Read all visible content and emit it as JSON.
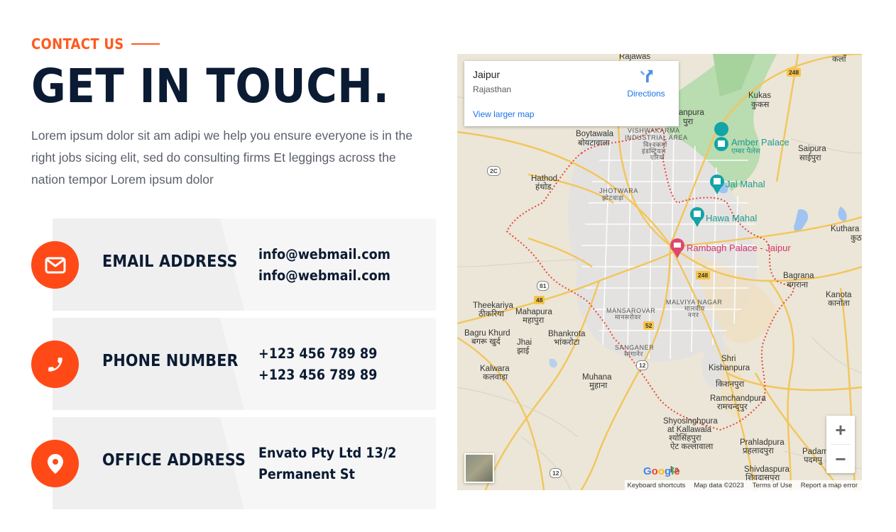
{
  "section": {
    "eyebrow": "CONTACT US",
    "title": "GET IN TOUCH.",
    "intro": "Lorem ipsum dolor sit am adipi we help you ensure everyone is in the right jobs sicing elit, sed do consulting firms Et leggings across the nation tempor Lorem ipsum dolor"
  },
  "cards": [
    {
      "label": "EMAIL ADDRESS",
      "line1": "info@webmail.com",
      "line2": "info@webmail.com",
      "icon": "envelope-icon"
    },
    {
      "label": "PHONE NUMBER",
      "line1": "+123 456 789 89",
      "line2": "+123 456 789 89",
      "icon": "phone-icon"
    },
    {
      "label": "OFFICE ADDRESS",
      "line1": "Envato Pty Ltd 13/2",
      "line2": "Permanent St",
      "icon": "map-pin-icon"
    }
  ],
  "map": {
    "place": "Jaipur",
    "region": "Rajasthan",
    "directions": "Directions",
    "larger_map": "View larger map",
    "google": "Google",
    "attribution": [
      "Keyboard shortcuts",
      "Map data ©2023",
      "Terms of Use",
      "Report a map error"
    ],
    "labels": {
      "rajawas": "Rajawas",
      "kalan": "कलाँ",
      "kukas": "Kukas",
      "kukas_hi": "कुकस",
      "jaisinghpura": "anpura",
      "jaisinghpura_hi": "पुरा",
      "boytawala": "Boytawala",
      "boytawala_hi": "बोयटावाला",
      "vishwakarma": "VISHWAKARMA",
      "industrial_area": "INDUSTRIAL AREA",
      "vish_hi1": "विश्वकर्मा",
      "vish_hi2": "इंडस्ट्रियल",
      "vish_hi3": "एरिया",
      "amber": "Amber Palace",
      "amber_hi": "एम्बर पैलेस",
      "saipura": "Saipura",
      "saipura_hi": "साईपुरा",
      "hathod": "Hathod",
      "hathod_hi": "हंथोड",
      "jhotwara": "JHOTWARA",
      "jhotwara_hi": "झोटवाड़ा",
      "jal_mahal": "Jal Mahal",
      "hawa_mahal": "Hawa Mahal",
      "kuthara": "Kuthara",
      "kuthara_hi": "कुठा",
      "rambagh": "Rambagh Palace - Jaipur",
      "bagrana": "Bagrana",
      "bagrana_hi": "बगराना",
      "kanota": "Kanota",
      "kanota_hi": "कानोता",
      "theekariya": "Theekariya",
      "theekariya_hi": "ठीकरिया",
      "mahapura": "Mahapura",
      "mahapura_hi": "महापुरा",
      "mansarovar": "MANSAROVAR",
      "mansarovar_hi": "मानसरोवर",
      "malviya": "MALVIYA NAGAR",
      "malviya_hi1": "मालवीय",
      "malviya_hi2": "नगर",
      "bagru": "Bagru Khurd",
      "bagru_hi": "बगरू खुर्द",
      "jhai": "Jhai",
      "jhai_hi": "झाई",
      "bhankrota": "Bhankrota",
      "bhankrota_hi": "भांकरोटा",
      "sanganer": "SANGANER",
      "sanganer_hi": "सांगानेर",
      "shri": "Shri",
      "kishanpura": "Kishanpura",
      "kishanpura_hi": "किशनपुरा",
      "kalwara": "Kalwara",
      "kalwara_hi": "कलवाड़ा",
      "muhana": "Muhana",
      "muhana_hi": "मुहाना",
      "ramchand": "Ramchandpura",
      "ramchand_hi": "रामचन्द्पुर",
      "shyosinghpura": "Shyosinghpura",
      "at_kalwala": "at Kallawala",
      "shyo_hi1": "श्योसिंहपुरा",
      "shyo_hi2": "ऐट कल्लावाला",
      "prahladpura": "Prahladpura",
      "prahladpura_hi": "प्रहलादपुरा",
      "padamp": "Padamp",
      "padamp_hi": "पदमपु",
      "shivdaspura": "Shivdaspura",
      "shivdaspura_hi": "शिवदासपुरा",
      "ka": "ka"
    },
    "shields": [
      "2C",
      "248",
      "248",
      "81",
      "48",
      "52",
      "12",
      "12"
    ]
  }
}
